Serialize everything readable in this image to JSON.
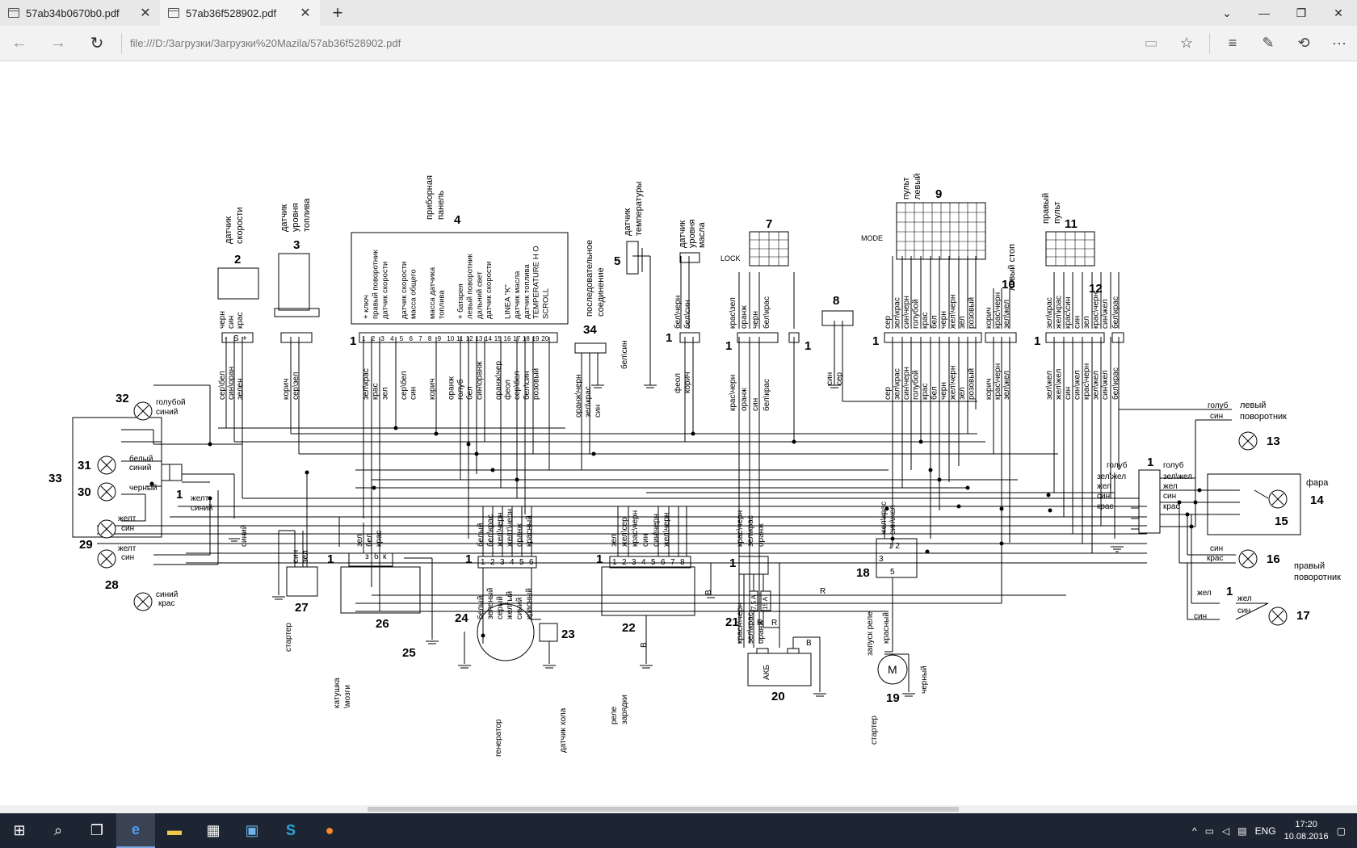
{
  "browser": {
    "tabs": [
      {
        "title": "57ab34b0670b0.pdf",
        "active": false
      },
      {
        "title": "57ab36f528902.pdf",
        "active": true
      }
    ],
    "url": "file:///D:/Загрузки/Загрузки%20Mazila/57ab36f528902.pdf"
  },
  "diagram": {
    "n1": "1",
    "n2": "2",
    "n3": "3",
    "n4": "4",
    "n5": "5",
    "n7": "7",
    "n8": "8",
    "n9": "9",
    "n10": "10",
    "n11": "11",
    "n12": "12",
    "n13": "13",
    "n14": "14",
    "n15": "15",
    "n16": "16",
    "n17": "17",
    "n18": "18",
    "n19": "19",
    "n20": "20",
    "n21": "21",
    "n22": "22",
    "n23": "23",
    "n24": "24",
    "n25": "25",
    "n26": "26",
    "n27": "27",
    "n28": "28",
    "n29": "29",
    "n30": "30",
    "n31": "31",
    "n32": "32",
    "n33": "33",
    "n34": "34",
    "speed_sensor": [
      "датчик",
      "скорости"
    ],
    "fuel_sensor": [
      "датчик",
      "уровня",
      "топлива"
    ],
    "panel": [
      "приборная",
      "панель"
    ],
    "temp_sensor": [
      "датчик",
      "температуры"
    ],
    "oil_sensor": [
      "датчик",
      "уровня",
      "масла"
    ],
    "series_conn": [
      "последовательное",
      "соединение"
    ],
    "left_remote": [
      "пульт",
      "левый"
    ],
    "right_remote": [
      "правый",
      "пульт"
    ],
    "left_stop": "левый стоп",
    "left_turn": [
      "левый",
      "поворотник"
    ],
    "right_turn": [
      "правый",
      "поворотник"
    ],
    "headlight": "фара",
    "lock": "LOCK",
    "mode": "MODE",
    "panel_pins": [
      "+ ключ",
      "правый поворотник",
      "датчик скорости",
      "",
      "датчик скорости",
      "масса общего",
      "",
      "масса датчика",
      "топлива",
      "",
      "+ батарея",
      "левый поворотник",
      "дальний свет",
      "датчик скорости",
      "",
      "LINEA \"K\"",
      "датчик масла",
      "датчик топлива",
      "TEMPERATURE H O",
      "SCROLL"
    ],
    "panel_pin_nums": [
      "1",
      "2",
      "3",
      "4",
      "5",
      "6",
      "7",
      "8",
      "9",
      "10",
      "11",
      "12",
      "13",
      "14",
      "15",
      "16",
      "17",
      "18",
      "19",
      "20"
    ],
    "panel_wires": [
      "зел\\крас",
      "крас",
      "зел",
      "",
      "сер\\бел",
      "син",
      "",
      "корич",
      "",
      "оранж",
      "голуб",
      "бел",
      "син\\оранж",
      "",
      "оранж\\чер",
      "феол",
      "сер\\бел",
      "бел\\син",
      "розовый",
      ""
    ],
    "speed_wires_top": [
      "черн",
      "син",
      "крас"
    ],
    "speed_pins": [
      "-",
      "S",
      "+"
    ],
    "speed_wires": [
      "сер\\бел",
      "син\\оран",
      "зелен"
    ],
    "fuel_wires": [
      "корич",
      "сер\\зел"
    ],
    "conn34_wires": [
      "оранж\\черн",
      "зел\\крас",
      "син"
    ],
    "temp_wire": "бел\\син",
    "oil_wires_top": [
      "бел\\черн",
      "бел\\син"
    ],
    "oil_wires": [
      "феол",
      "корич"
    ],
    "c7_wires_top": [
      "крас\\зел",
      "оранж",
      "черн",
      "бел\\крас"
    ],
    "c7_wires": [
      "крас\\черн",
      "оранж",
      "син",
      "бел\\крас"
    ],
    "c8_wires": [
      "син",
      "сер"
    ],
    "c9_wires_top": [
      "сер",
      "зел\\крас",
      "син\\черн",
      "голубой",
      "крас",
      "бел",
      "черн",
      "жел\\черн",
      "зел",
      "розовый"
    ],
    "c9_wires": [
      "сер",
      "зел\\крас",
      "син\\черн",
      "голубой",
      "крас",
      "бел",
      "черн",
      "жел\\черн",
      "зел",
      "розовый"
    ],
    "c10_wires": [
      "корич",
      "крас\\черн",
      "зел\\жел"
    ],
    "c11_wires_top": [
      "зел\\крас",
      "жел\\крас",
      "крас\\син",
      "син",
      "зел",
      "крас\\черн",
      "син\\жел"
    ],
    "c11_wires": [
      "зел\\жел",
      "жел\\жел",
      "син",
      "син\\жел",
      "крас\\черн",
      "зел\\жел",
      "син\\жел"
    ],
    "c12_wires": [
      "бел\\крас"
    ],
    "l32": [
      "голубой",
      "синий"
    ],
    "l31": [
      "белый",
      "синий"
    ],
    "l30": "черный",
    "l29a": [
      "желт",
      "син"
    ],
    "l29b": [
      "желт",
      "син"
    ],
    "l33c": [
      "желт",
      "синий"
    ],
    "l28": [
      "синий",
      "крас"
    ],
    "gnd_sin": "синий",
    "c27_wires": [
      "син",
      "зел"
    ],
    "starter": "стартер",
    "c26_wires": [
      "зел",
      "бел",
      "крас"
    ],
    "c26_pins": [
      "з",
      "б",
      "к"
    ],
    "coil": [
      "катушка",
      "\\мозги"
    ],
    "gen_wires_top": [
      "белый",
      "бел\\крас",
      "жел\\черн",
      "желт\\черн",
      "оранж",
      "красный"
    ],
    "gen_wires": [
      "белый",
      "зеленый",
      "серый",
      "желтый",
      "синий",
      "красный"
    ],
    "gen_pins": [
      "1",
      "2",
      "3",
      "4",
      "5",
      "6"
    ],
    "generator": "генератор",
    "hall": "датчик хола",
    "c22_wires": [
      "зел",
      "жел\\сер",
      "крас\\черн",
      "син",
      "син\\черн",
      "жел\\черн"
    ],
    "c22_pins": [
      "1",
      "2",
      "3",
      "4",
      "5",
      "6",
      "7",
      "8"
    ],
    "relay_charge": [
      "реле",
      "зарядки"
    ],
    "letter_b": "B",
    "letter_r": "R",
    "c21_wires_top": [
      "крас\\черн",
      "зел\\крас",
      "оранж"
    ],
    "c21_wires": [
      "красн\\черн",
      "зел\\крас",
      "оранж"
    ],
    "fuse1": "7,5 A",
    "fuse2": "15 A",
    "akb": "АКБ",
    "c18_wires": [
      "жел\\крас",
      "син\\жел"
    ],
    "relay_pins": [
      "1 2",
      "3",
      "5"
    ],
    "start_relay": "запуск реле",
    "red": "красный",
    "black": "черный",
    "motor": "M",
    "r13": [
      "голуб",
      "син"
    ],
    "c1_left": [
      "голуб",
      "зел\\жел",
      "жел",
      "син",
      "крас"
    ],
    "c1_right": [
      "голуб",
      "зел\\жел",
      "жел",
      "син",
      "крас"
    ],
    "r16": [
      "син",
      "крас"
    ],
    "r17a": [
      "жел",
      "син"
    ],
    "r17b": [
      "жел",
      "син"
    ]
  },
  "taskbar": {
    "lang": "ENG",
    "time": "17:20",
    "date": "10.08.2016"
  }
}
